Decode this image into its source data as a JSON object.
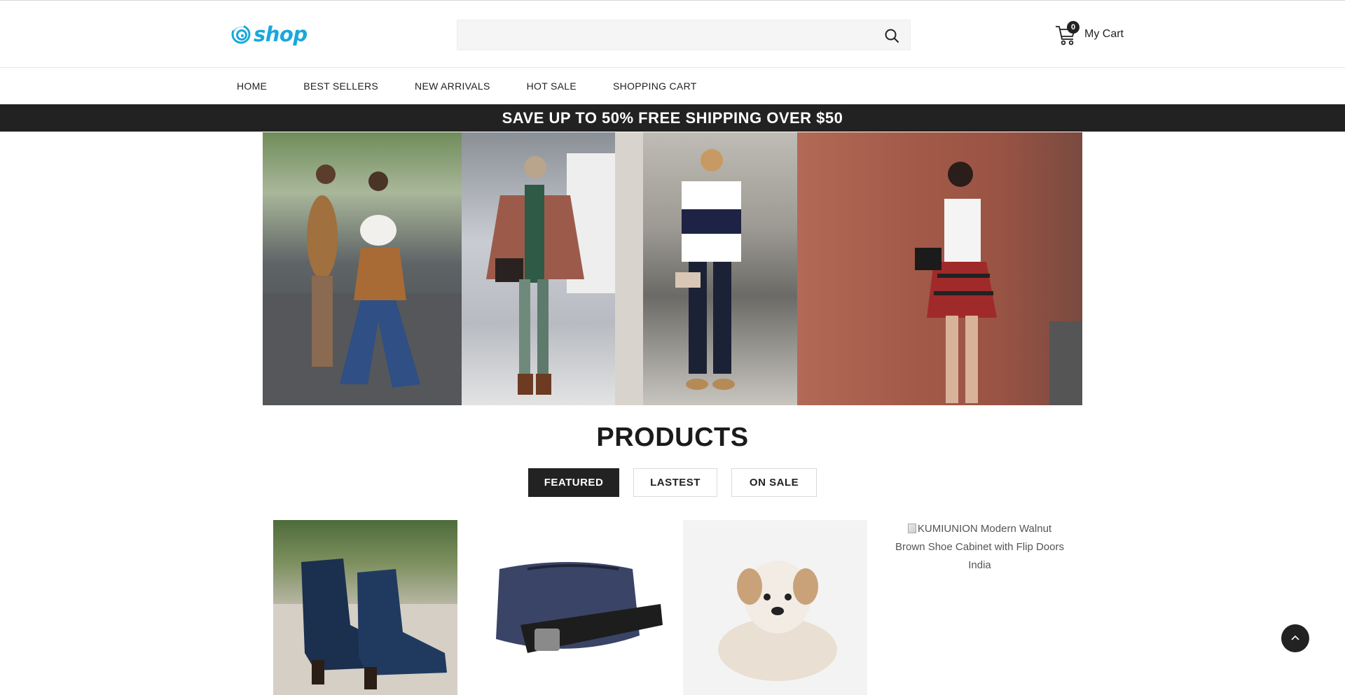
{
  "header": {
    "logo_text": "shop",
    "search": {
      "value": "",
      "placeholder": ""
    },
    "cart": {
      "count": "0",
      "label": "My Cart"
    }
  },
  "nav": {
    "items": [
      {
        "label": "HOME"
      },
      {
        "label": "BEST SELLERS"
      },
      {
        "label": "NEW ARRIVALS"
      },
      {
        "label": "HOT SALE"
      },
      {
        "label": "SHOPPING CART"
      }
    ]
  },
  "promo": {
    "text": "SAVE UP TO 50% FREE SHIPPING OVER $50"
  },
  "products": {
    "title": "PRODUCTS",
    "tabs": [
      {
        "label": "FEATURED",
        "active": true
      },
      {
        "label": "LASTEST",
        "active": false
      },
      {
        "label": "ON SALE",
        "active": false
      }
    ],
    "items": [
      {
        "image": "ankle-boots-photo"
      },
      {
        "image": "belt-bag-photo"
      },
      {
        "image": "puppy-photo"
      },
      {
        "image_alt": "KUMIUNION Modern Walnut Brown Shoe Cabinet with Flip Doors India"
      }
    ]
  },
  "colors": {
    "accent": "#1aa7dc",
    "dark": "#222222",
    "search_bg": "#f5f5f5"
  }
}
